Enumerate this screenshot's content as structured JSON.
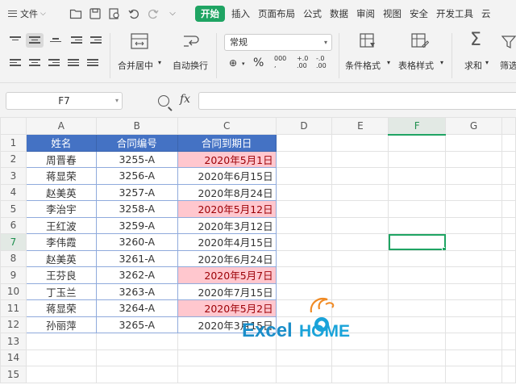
{
  "menu": {
    "file_label": "文件",
    "tabs": [
      "开始",
      "插入",
      "页面布局",
      "公式",
      "数据",
      "审阅",
      "视图",
      "安全",
      "开发工具",
      "云"
    ]
  },
  "ribbon": {
    "merge_label": "合并居中",
    "wrap_label": "自动换行",
    "number_format": "常规",
    "cond_format_label": "条件格式",
    "table_style_label": "表格样式",
    "sum_label": "求和",
    "filter_label": "筛选",
    "percent_symbol": "%",
    "currency_symbol": "¥"
  },
  "formula_bar": {
    "name_box": "F7",
    "fx": "fx",
    "formula": ""
  },
  "sheet": {
    "columns": [
      "A",
      "B",
      "C",
      "D",
      "E",
      "F",
      "G"
    ],
    "selected_column": "F",
    "selected_row": 7,
    "active_cell": "F7",
    "rows": [
      "1",
      "2",
      "3",
      "4",
      "5",
      "6",
      "7",
      "8",
      "9",
      "10",
      "11",
      "12",
      "13",
      "14",
      "15"
    ],
    "headers": [
      "姓名",
      "合同编号",
      "合同到期日"
    ],
    "data": [
      {
        "name": "周晋春",
        "id": "3255-A",
        "date": "2020年5月1日",
        "highlight": true
      },
      {
        "name": "蒋显荣",
        "id": "3256-A",
        "date": "2020年6月15日",
        "highlight": false
      },
      {
        "name": "赵美英",
        "id": "3257-A",
        "date": "2020年8月24日",
        "highlight": false
      },
      {
        "name": "李治宇",
        "id": "3258-A",
        "date": "2020年5月12日",
        "highlight": true
      },
      {
        "name": "王红波",
        "id": "3259-A",
        "date": "2020年3月12日",
        "highlight": false
      },
      {
        "name": "李伟霞",
        "id": "3260-A",
        "date": "2020年4月15日",
        "highlight": false
      },
      {
        "name": "赵美英",
        "id": "3261-A",
        "date": "2020年6月24日",
        "highlight": false
      },
      {
        "name": "王芬良",
        "id": "3262-A",
        "date": "2020年5月7日",
        "highlight": true
      },
      {
        "name": "丁玉兰",
        "id": "3263-A",
        "date": "2020年7月15日",
        "highlight": false
      },
      {
        "name": "蒋显荣",
        "id": "3264-A",
        "date": "2020年5月2日",
        "highlight": true
      },
      {
        "name": "孙丽萍",
        "id": "3265-A",
        "date": "2020年3月15日",
        "highlight": false
      }
    ]
  },
  "watermark": {
    "text_excel": "Excel",
    "text_home": "HOME"
  },
  "colors": {
    "accent": "#1fa463",
    "header_fill": "#4472c4",
    "highlight_fill": "#ffc7ce",
    "highlight_text": "#9c0006"
  }
}
